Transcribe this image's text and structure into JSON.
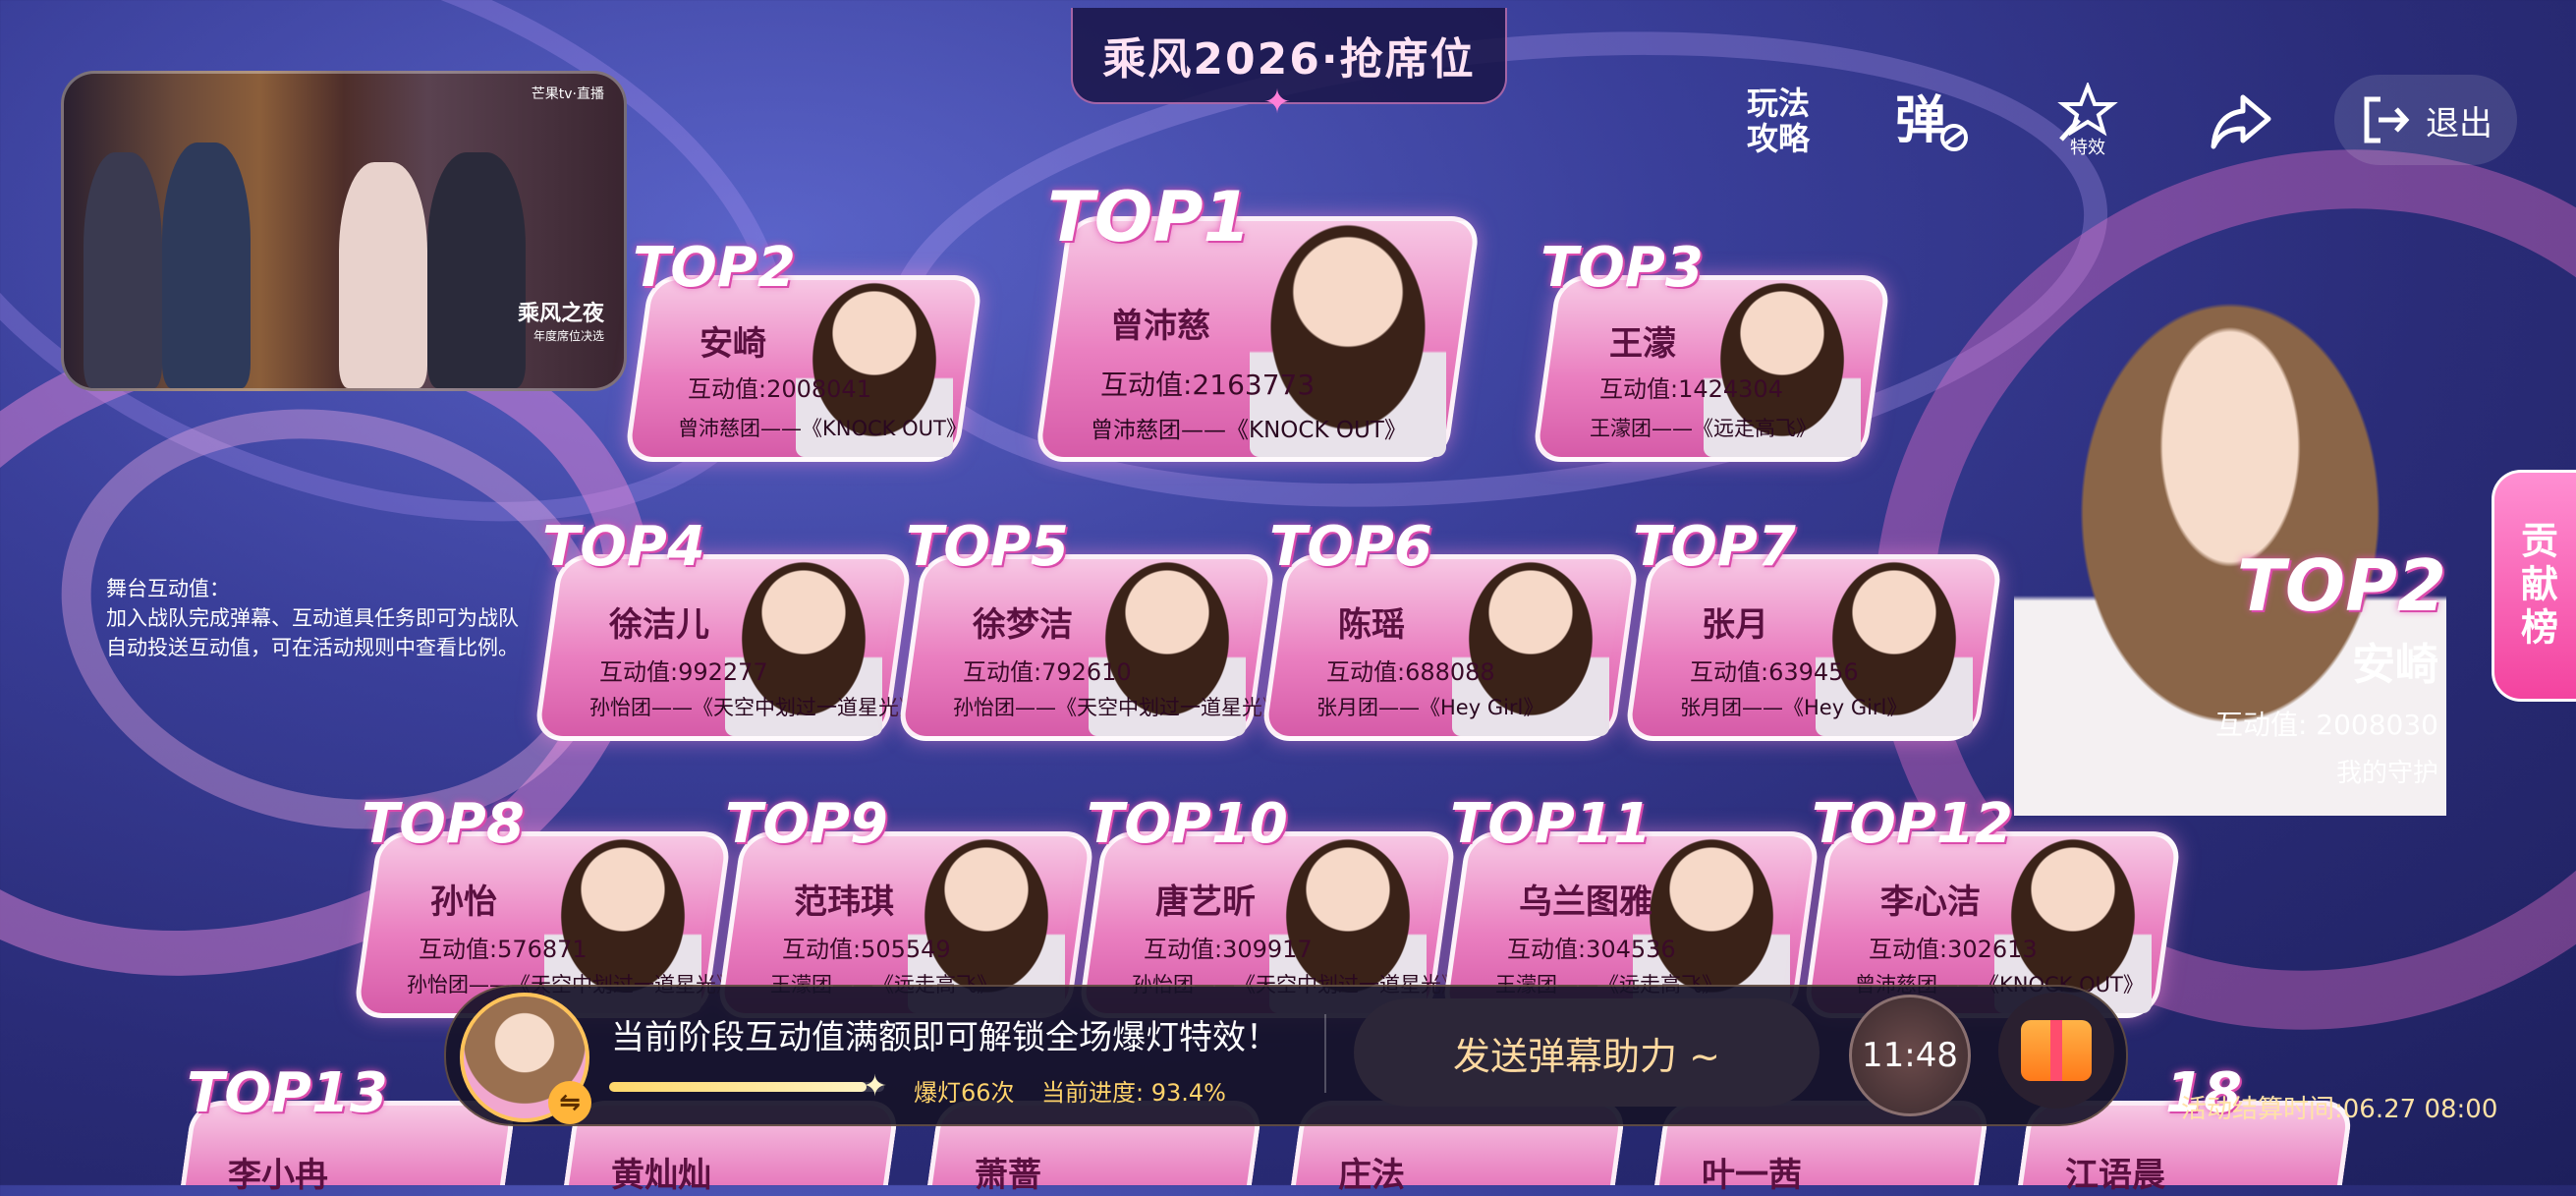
{
  "header": {
    "title": "乘风2026·抢席位"
  },
  "video": {
    "logo": "芒果tv·直播",
    "badge_title": "乘风之夜",
    "badge_sub": "年度席位决选"
  },
  "toolbar": {
    "guide_line1": "玩法",
    "guide_line2": "攻略",
    "danmaku_icon": "danmaku-toggle-icon",
    "effects_label": "特效",
    "share_icon": "share-icon",
    "exit_label": "退出"
  },
  "stage_info": {
    "title": "舞台互动值：",
    "text": "加入战队完成弹幕、互动道具任务即可为战队自动投送互动值，可在活动规则中查看比例。"
  },
  "ranking": [
    {
      "rank": "TOP1",
      "name": "曾沛慈",
      "score": "互动值:2163773",
      "group": "曾沛慈团——《KNOCK OUT》"
    },
    {
      "rank": "TOP2",
      "name": "安崎",
      "score": "互动值:2008041",
      "group": "曾沛慈团——《KNOCK OUT》"
    },
    {
      "rank": "TOP3",
      "name": "王濛",
      "score": "互动值:1424304",
      "group": "王濛团——《远走高飞》"
    },
    {
      "rank": "TOP4",
      "name": "徐洁儿",
      "score": "互动值:992277",
      "group": "孙怡团——《天空中划过一道星光》"
    },
    {
      "rank": "TOP5",
      "name": "徐梦洁",
      "score": "互动值:792610",
      "group": "孙怡团——《天空中划过一道星光》"
    },
    {
      "rank": "TOP6",
      "name": "陈瑶",
      "score": "互动值:688088",
      "group": "张月团——《Hey Girl》"
    },
    {
      "rank": "TOP7",
      "name": "张月",
      "score": "互动值:639456",
      "group": "张月团——《Hey Girl》"
    },
    {
      "rank": "TOP8",
      "name": "孙怡",
      "score": "互动值:576871",
      "group": "孙怡团——《天空中划过一道星光》"
    },
    {
      "rank": "TOP9",
      "name": "范玮琪",
      "score": "互动值:505549",
      "group": "王濛团——《远走高飞》"
    },
    {
      "rank": "TOP10",
      "name": "唐艺昕",
      "score": "互动值:309917",
      "group": "孙怡团——《天空中划过一道星光》"
    },
    {
      "rank": "TOP11",
      "name": "乌兰图雅",
      "score": "互动值:304536",
      "group": "王濛团——《远走高飞》"
    },
    {
      "rank": "TOP12",
      "name": "李心洁",
      "score": "互动值:302613",
      "group": "曾沛慈团——《KNOCK OUT》"
    }
  ],
  "partial_row": [
    {
      "rank": "TOP13",
      "name": "李小冉"
    },
    {
      "rank": "",
      "name": "黄灿灿"
    },
    {
      "rank": "",
      "name": "萧蔷"
    },
    {
      "rank": "",
      "name": "庄法"
    },
    {
      "rank": "",
      "name": "叶一茜"
    },
    {
      "rank": "18",
      "name": "江语晨"
    }
  ],
  "hero": {
    "rank": "TOP2",
    "name": "安崎",
    "score": "互动值: 2008030",
    "guard": "我的守护"
  },
  "contribution_tab": "贡献榜",
  "bottom_bar": {
    "message": "当前阶段互动值满额即可解锁全场爆灯特效！",
    "lights": "爆灯66次",
    "progress_text": "当前进度: 93.4%",
    "progress": 0.934,
    "send_label": "发送弹幕助力 ~",
    "timer": "11:48",
    "settle_time": "活动结算时间:06.27 08:00"
  },
  "colors": {
    "accent_pink": "#e77abd",
    "gold": "#ffd36b",
    "background": "#2a2c78"
  }
}
